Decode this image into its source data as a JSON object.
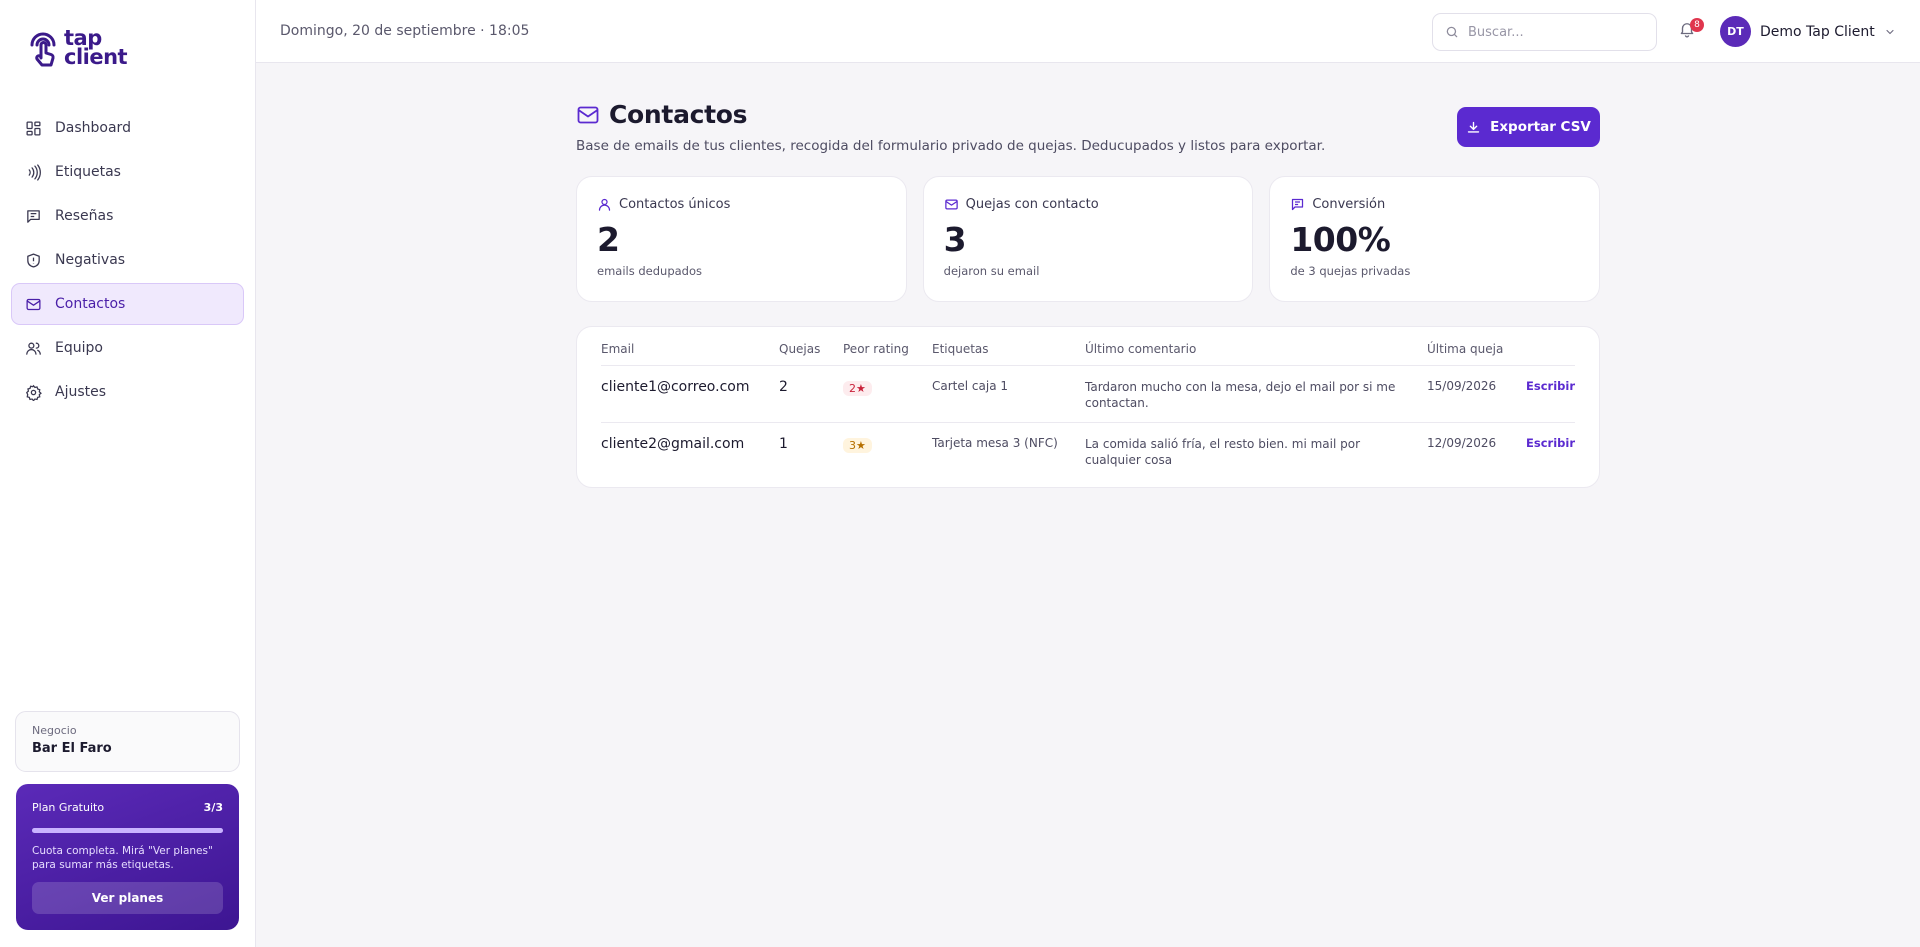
{
  "brand": {
    "logo_line1": "tap",
    "logo_line2": "client"
  },
  "sidebar": {
    "items": [
      {
        "label": "Dashboard",
        "icon": "dashboard-icon"
      },
      {
        "label": "Etiquetas",
        "icon": "nfc-icon"
      },
      {
        "label": "Reseñas",
        "icon": "review-icon"
      },
      {
        "label": "Negativas",
        "icon": "shield-icon"
      },
      {
        "label": "Contactos",
        "icon": "mail-icon",
        "active": true
      },
      {
        "label": "Equipo",
        "icon": "team-icon"
      },
      {
        "label": "Ajustes",
        "icon": "gear-icon"
      }
    ],
    "business": {
      "label": "Negocio",
      "name": "Bar El Faro"
    },
    "plan": {
      "name": "Plan Gratuito",
      "usage": "3/3",
      "progress": 1.0,
      "message": "Cuota completa. Mirá \"Ver planes\" para sumar más etiquetas.",
      "button": "Ver planes"
    }
  },
  "topbar": {
    "date": "Domingo, 20 de septiembre · 18:05",
    "search_placeholder": "Buscar...",
    "notifications": "8",
    "user_initials": "DT",
    "user_name": "Demo Tap Client"
  },
  "page": {
    "title": "Contactos",
    "subtitle": "Base de emails de tus clientes, recogida del formulario privado de quejas. Deducupados y listos para exportar.",
    "export_label": "Exportar CSV"
  },
  "stats": [
    {
      "label": "Contactos únicos",
      "value": "2",
      "sub": "emails dedupados",
      "icon": "user-icon"
    },
    {
      "label": "Quejas con contacto",
      "value": "3",
      "sub": "dejaron su email",
      "icon": "mail-icon"
    },
    {
      "label": "Conversión",
      "value": "100%",
      "sub": "de 3 quejas privadas",
      "icon": "chat-icon"
    }
  ],
  "table": {
    "headers": [
      "Email",
      "Quejas",
      "Peor rating",
      "Etiquetas",
      "Último comentario",
      "Última queja",
      ""
    ],
    "rows": [
      {
        "email": "cliente1@correo.com",
        "quejas": "2",
        "rating": "2★",
        "etiqueta": "Cartel caja 1",
        "comentario": "Tardaron mucho con la mesa, dejo el mail por si me contactan.",
        "fecha": "15/09/2026",
        "action": "Escribir"
      },
      {
        "email": "cliente2@gmail.com",
        "quejas": "1",
        "rating": "3★",
        "etiqueta": "Tarjeta mesa 3 (NFC)",
        "comentario": "La comida salió fría, el resto bien. mi mail por cualquier cosa",
        "fecha": "12/09/2026",
        "action": "Escribir"
      }
    ]
  },
  "colors": {
    "accent": "#5b2ad0",
    "brand": "#3b1a8a",
    "danger": "#e0364e"
  }
}
